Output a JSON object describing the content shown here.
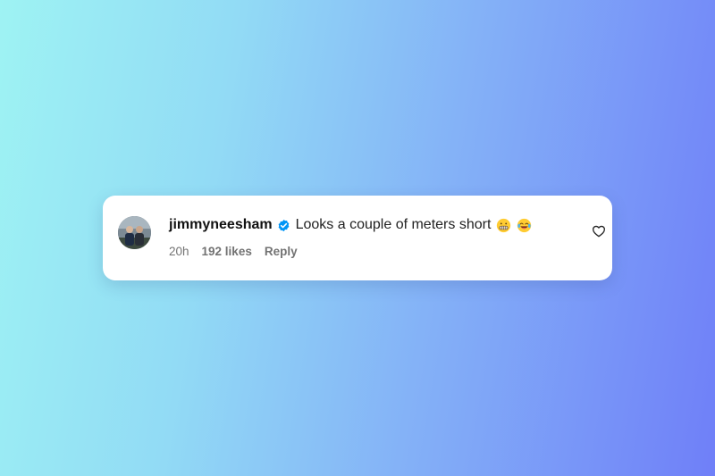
{
  "comment": {
    "avatar_icon": "profile-photo",
    "username": "jimmyneesham",
    "verified_icon": "verified-badge-icon",
    "text": "Looks a couple of meters short",
    "emojis": [
      "grimacing-face-emoji",
      "face-with-tears-of-joy-emoji"
    ],
    "time": "20h",
    "likes_label": "192 likes",
    "reply_label": "Reply",
    "like_icon": "heart-outline-icon"
  },
  "colors": {
    "background_start": "#9ef3f3",
    "background_end": "#6f7ff8",
    "verified_badge": "#0095f6",
    "meta_text": "#737373"
  }
}
